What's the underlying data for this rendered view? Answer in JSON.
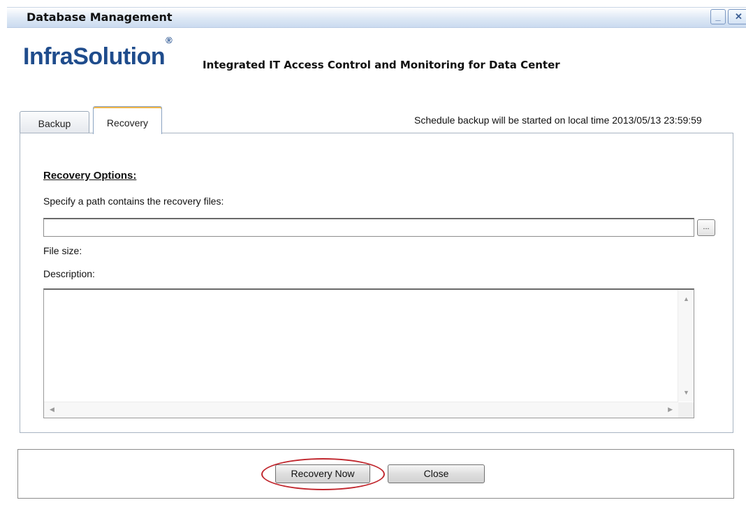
{
  "window": {
    "title": "Database Management",
    "minimize_glyph": "_",
    "close_glyph": "✕"
  },
  "header": {
    "logo_part1": "Infra",
    "logo_part2": "Solution",
    "logo_registered": "®",
    "tagline": "Integrated IT Access Control and Monitoring for Data Center"
  },
  "tabs": [
    {
      "label": "Backup",
      "active": false
    },
    {
      "label": "Recovery",
      "active": true
    }
  ],
  "schedule_text": "Schedule backup will be started on local time 2013/05/13  23:59:59",
  "recovery": {
    "section_title": "Recovery Options:",
    "path_label": "Specify a path contains the recovery files:",
    "path_value": "",
    "browse_label": "...",
    "file_size_label": "File size:",
    "description_label": "Description:",
    "description_value": ""
  },
  "buttons": {
    "recovery_now": "Recovery Now",
    "close": "Close"
  },
  "colors": {
    "highlight": "#c0262d",
    "brand": "#1f4c8c"
  }
}
